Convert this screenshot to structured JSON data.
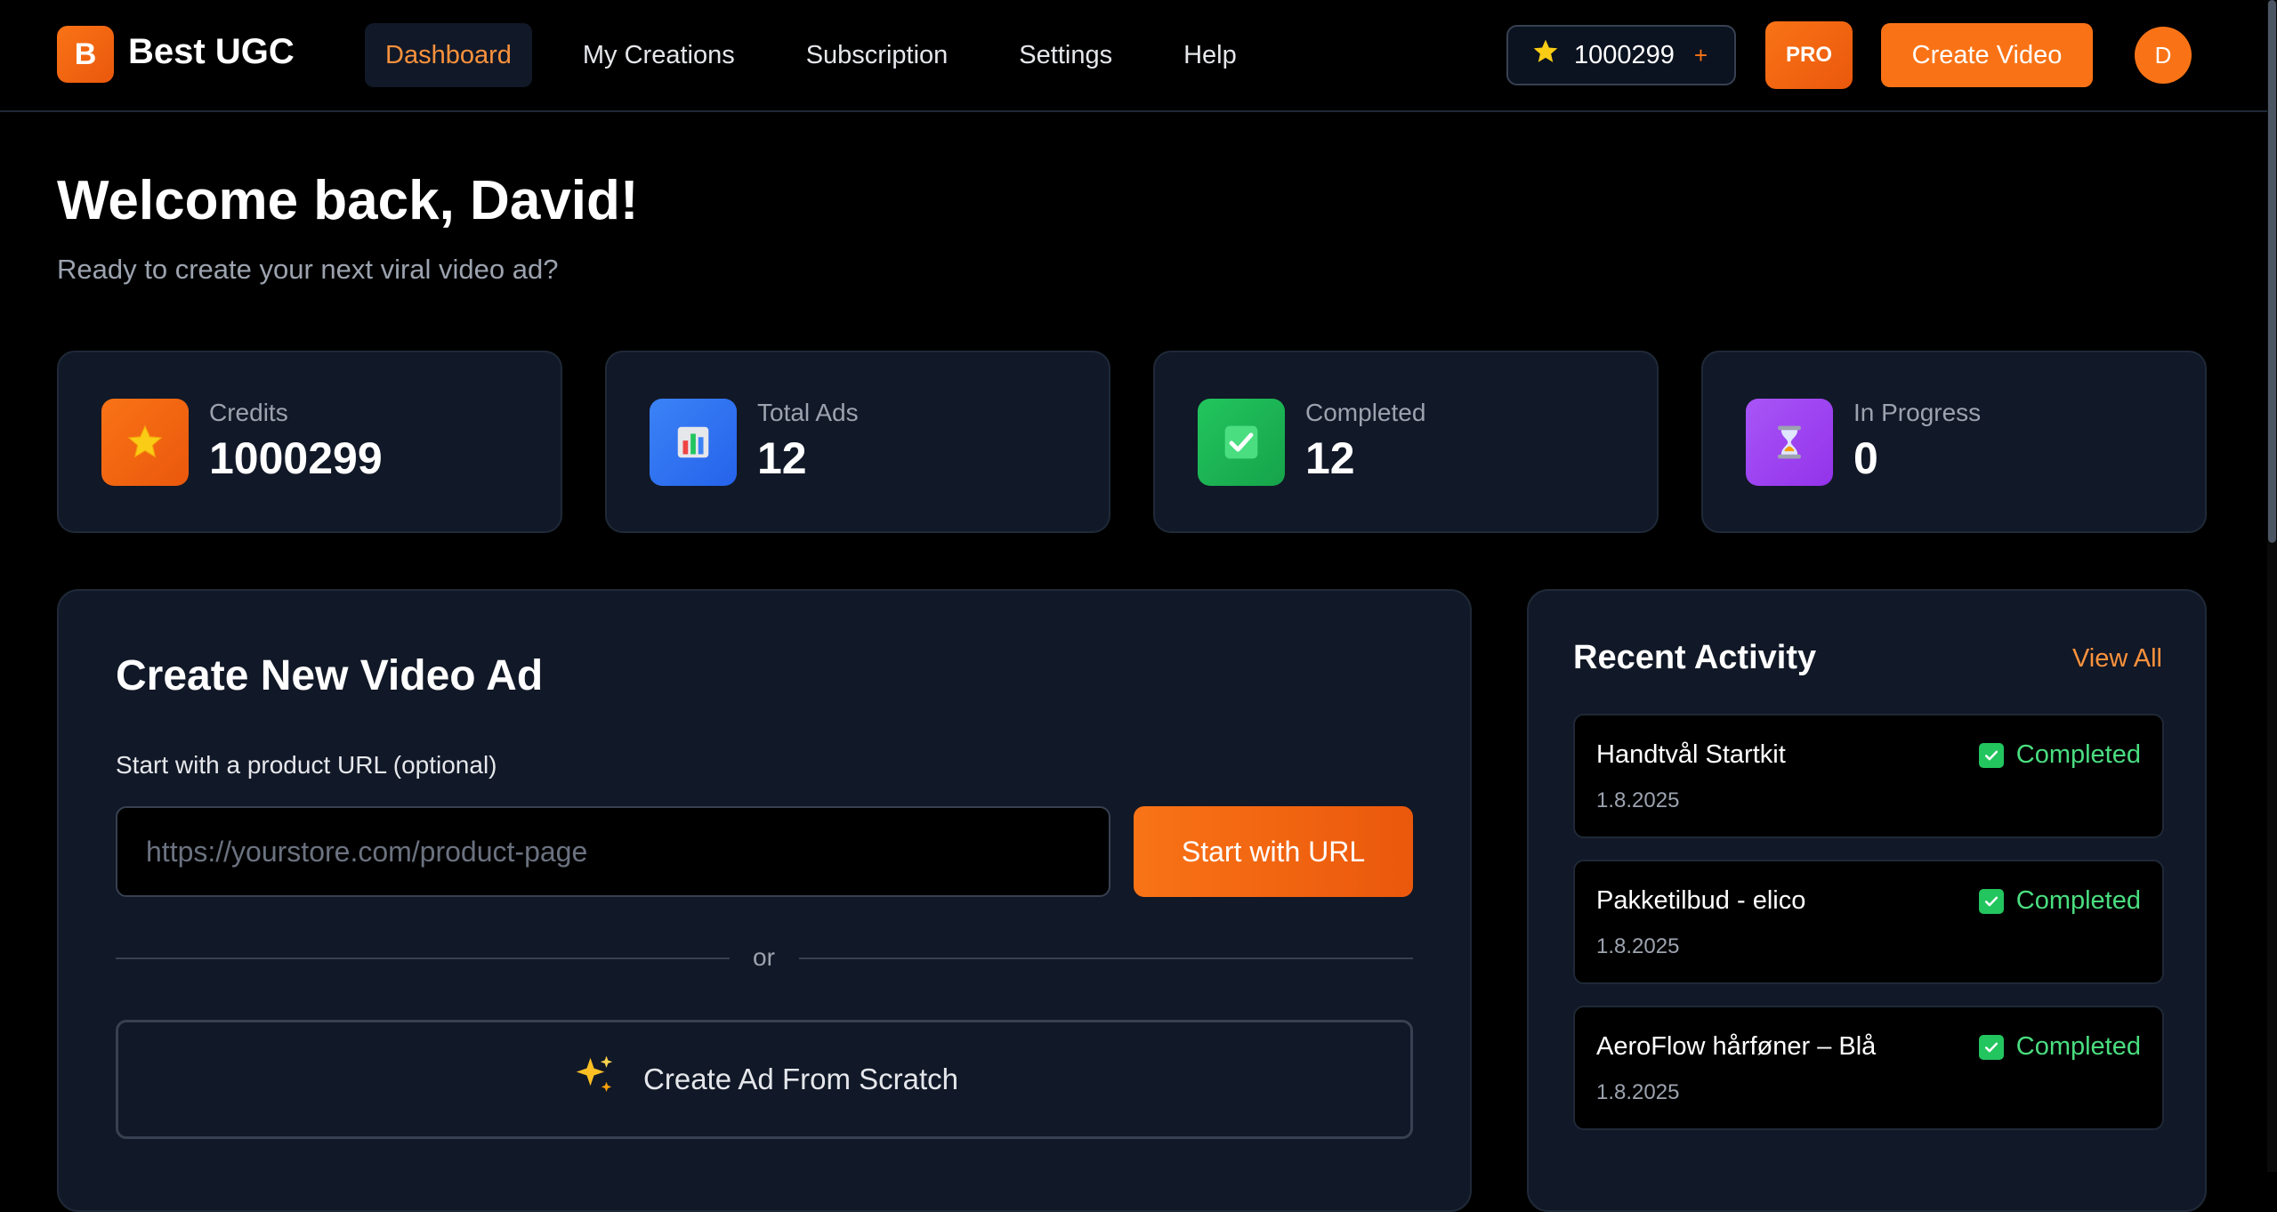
{
  "brand": {
    "logo_letter": "B",
    "name": "Best UGC"
  },
  "nav": {
    "items": [
      {
        "label": "Dashboard",
        "active": true
      },
      {
        "label": "My Creations",
        "active": false
      },
      {
        "label": "Subscription",
        "active": false
      },
      {
        "label": "Settings",
        "active": false
      },
      {
        "label": "Help",
        "active": false
      }
    ]
  },
  "header": {
    "credits": "1000299",
    "credits_plus": "+",
    "pro_label": "PRO",
    "create_video_label": "Create Video",
    "avatar_initial": "D"
  },
  "welcome": {
    "title": "Welcome back, David!",
    "subtitle": "Ready to create your next viral video ad?"
  },
  "stats": [
    {
      "label": "Credits",
      "value": "1000299",
      "icon": "star-icon",
      "color": "#f97316"
    },
    {
      "label": "Total Ads",
      "value": "12",
      "icon": "bar-chart-icon",
      "color": "#3b82f6"
    },
    {
      "label": "Completed",
      "value": "12",
      "icon": "check-icon",
      "color": "#22c55e"
    },
    {
      "label": "In Progress",
      "value": "0",
      "icon": "hourglass-icon",
      "color": "#a855f7"
    }
  ],
  "create": {
    "title": "Create New Video Ad",
    "url_label": "Start with a product URL (optional)",
    "url_placeholder": "https://yourstore.com/product-page",
    "url_button": "Start with URL",
    "divider_text": "or",
    "scratch_label": "Create Ad From Scratch"
  },
  "activity": {
    "title": "Recent Activity",
    "view_all": "View All",
    "items": [
      {
        "name": "Handtvål Startkit",
        "date": "1.8.2025",
        "status": "Completed"
      },
      {
        "name": "Pakketilbud - elico",
        "date": "1.8.2025",
        "status": "Completed"
      },
      {
        "name": "AeroFlow hårføner – Blå",
        "date": "1.8.2025",
        "status": "Completed"
      }
    ]
  },
  "colors": {
    "accent": "#f97316",
    "success": "#4ade80",
    "card_bg": "#111827",
    "page_bg": "#000000"
  }
}
